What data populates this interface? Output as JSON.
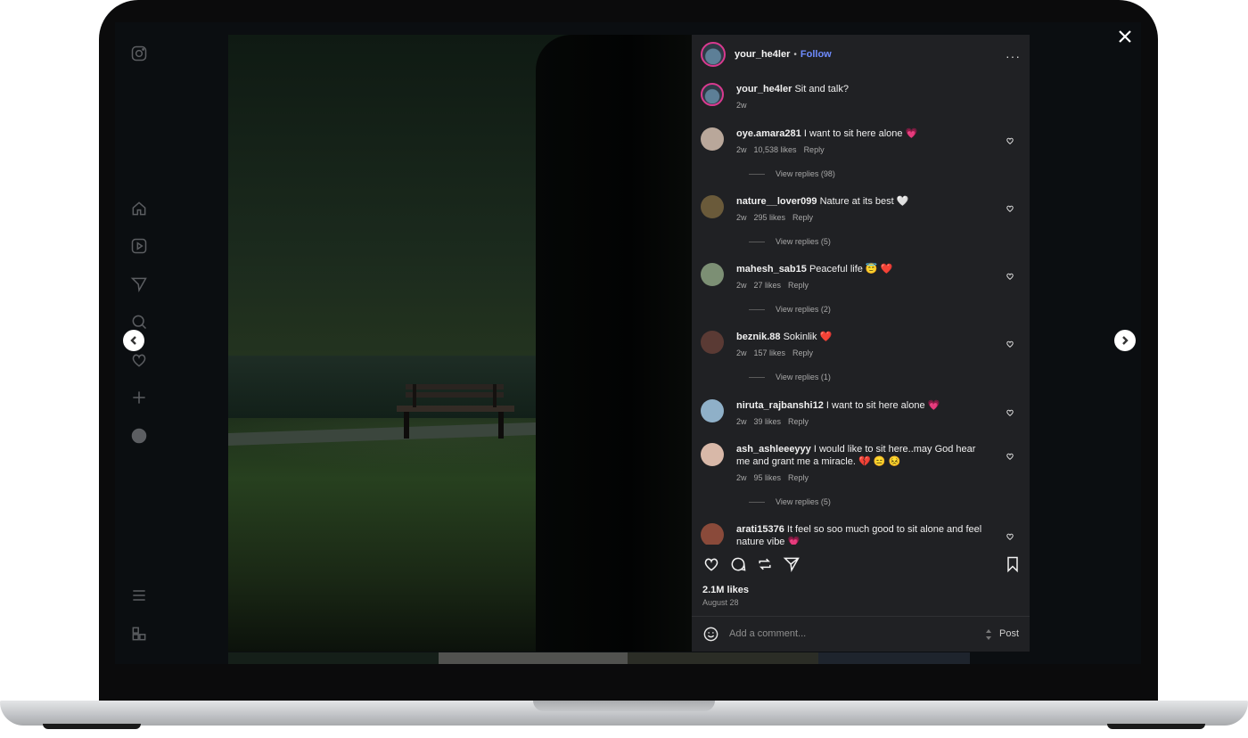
{
  "post": {
    "username": "your_he4ler",
    "separator": "•",
    "follow": "Follow",
    "more": "···",
    "caption": {
      "username": "your_he4ler",
      "text": "Sit and talk?",
      "time": "2w"
    }
  },
  "comments": [
    {
      "username": "oye.amara281",
      "text": "I want to sit here alone 💗",
      "time": "2w",
      "likes": "10,538 likes",
      "reply": "Reply",
      "replies": "View replies (98)",
      "avatar_color": "#b9a79a"
    },
    {
      "username": "nature__lover099",
      "text": "Nature at its best 🤍",
      "time": "2w",
      "likes": "295 likes",
      "reply": "Reply",
      "replies": "View replies (5)",
      "avatar_color": "#6a5a3a"
    },
    {
      "username": "mahesh_sab15",
      "text": "Peaceful life 😇 ❤️",
      "time": "2w",
      "likes": "27 likes",
      "reply": "Reply",
      "replies": "View replies (2)",
      "avatar_color": "#7c8f74"
    },
    {
      "username": "beznik.88",
      "text": "Sokinlik ❤️",
      "time": "2w",
      "likes": "157 likes",
      "reply": "Reply",
      "replies": "View replies (1)",
      "avatar_color": "#5a3a34"
    },
    {
      "username": "niruta_rajbanshi12",
      "text": "I want to sit here alone 💗",
      "time": "2w",
      "likes": "39 likes",
      "reply": "Reply",
      "replies": "",
      "avatar_color": "#8fb0c8"
    },
    {
      "username": "ash_ashleeeyyy",
      "text": "I would like to sit here..may God hear me and grant me a miracle. 💔 😑 😣",
      "time": "2w",
      "likes": "95 likes",
      "reply": "Reply",
      "replies": "View replies (5)",
      "avatar_color": "#d8b8a8"
    },
    {
      "username": "arati15376",
      "text": "It feel so soo much good to sit alone and feel nature vibe 💗",
      "time": "",
      "likes": "",
      "reply": "",
      "replies": "",
      "avatar_color": "#8a4a3a"
    }
  ],
  "footer": {
    "likes": "2.1M likes",
    "date": "August 28",
    "add_comment_placeholder": "Add a comment...",
    "post_label": "Post"
  },
  "sidebar_icons": [
    "instagram-icon",
    "home-icon",
    "reels-icon",
    "messages-icon",
    "search-icon",
    "notifications-icon",
    "create-icon",
    "profile-icon",
    "menu-icon",
    "more-apps-icon"
  ],
  "colors": {
    "panel_bg": "#202124",
    "follow": "#6f8cff",
    "story_ring": "#d83a8f"
  }
}
